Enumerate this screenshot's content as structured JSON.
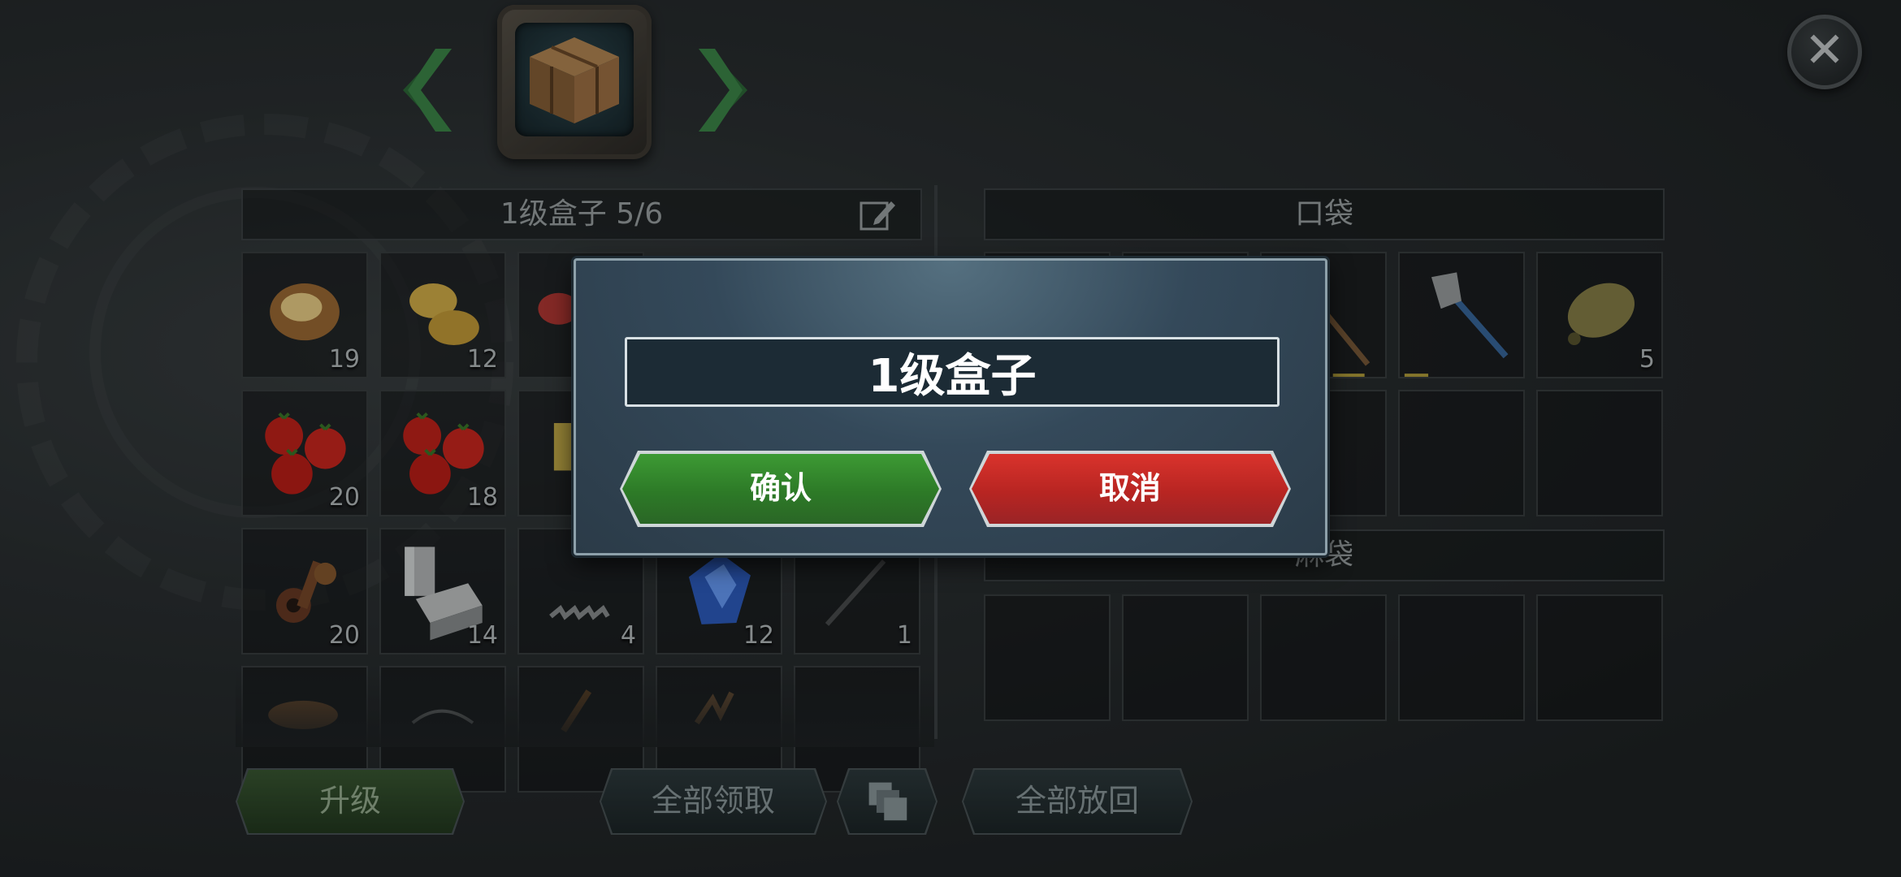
{
  "container": {
    "title": "1级盒子 5/6",
    "slots": [
      {
        "item": "baked-potato",
        "count": "19"
      },
      {
        "item": "potatoes",
        "count": "12"
      },
      {
        "item": "meat",
        "count": ""
      },
      {
        "item": "",
        "count": ""
      },
      {
        "item": "",
        "count": ""
      },
      {
        "item": "tomatoes",
        "count": "20"
      },
      {
        "item": "tomatoes",
        "count": "18"
      },
      {
        "item": "can",
        "count": ""
      },
      {
        "item": "",
        "count": ""
      },
      {
        "item": "",
        "count": ""
      },
      {
        "item": "scrap-metal",
        "count": "20"
      },
      {
        "item": "metal-blocks",
        "count": "14"
      },
      {
        "item": "spring",
        "count": "4"
      },
      {
        "item": "blue-crystal",
        "count": "12"
      },
      {
        "item": "drill-bit",
        "count": "1"
      }
    ]
  },
  "pocket": {
    "title": "口袋",
    "slots": [
      {
        "item": "",
        "count": ""
      },
      {
        "item": "",
        "count": ""
      },
      {
        "item": "pickaxe",
        "count": ""
      },
      {
        "item": "axe",
        "count": ""
      },
      {
        "item": "canteen",
        "count": "5"
      }
    ]
  },
  "bag": {
    "title": "麻袋"
  },
  "buttons": {
    "upgrade": "升级",
    "take_all": "全部领取",
    "put_all": "全部放回"
  },
  "dialog": {
    "name_value": "1级盒子",
    "confirm": "确认",
    "cancel": "取消"
  },
  "colors": {
    "confirm": "#2d7a27",
    "cancel": "#b82522",
    "dialog_bg": "#34495a"
  }
}
